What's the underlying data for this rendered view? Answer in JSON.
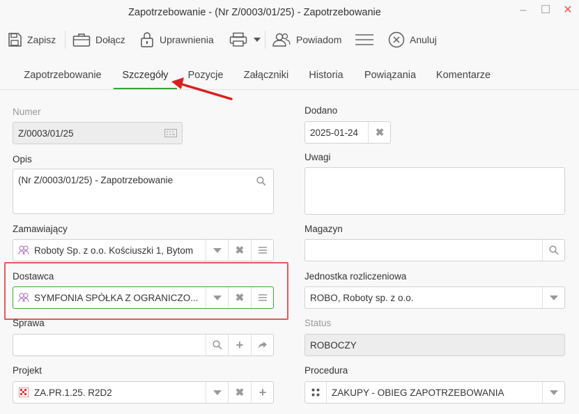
{
  "window": {
    "title": "Zapotrzebowanie - (Nr Z/0003/01/25) - Zapotrzebowanie"
  },
  "toolbar": {
    "save": "Zapisz",
    "attach": "Dołącz",
    "permissions": "Uprawnienia",
    "notify": "Powiadom",
    "cancel": "Anuluj"
  },
  "tabs": [
    "Zapotrzebowanie",
    "Szczegóły",
    "Pozycje",
    "Załączniki",
    "Historia",
    "Powiązania",
    "Komentarze"
  ],
  "active_tab": "Szczegóły",
  "form": {
    "numer": {
      "label": "Numer",
      "value": "Z/0003/01/25"
    },
    "opis": {
      "label": "Opis",
      "value": "(Nr Z/0003/01/25) - Zapotrzebowanie"
    },
    "zamawiajacy": {
      "label": "Zamawiający",
      "value": "Roboty Sp. z o.o. Kościuszki 1, Bytom"
    },
    "dostawca": {
      "label": "Dostawca",
      "value": "SYMFONIA SPÓŁKA Z OGRANICZO..."
    },
    "sprawa": {
      "label": "Sprawa",
      "value": ""
    },
    "projekt": {
      "label": "Projekt",
      "value": "ZA.PR.1.25. R2D2"
    },
    "dodano": {
      "label": "Dodano",
      "value": "2025-01-24"
    },
    "uwagi": {
      "label": "Uwagi",
      "value": ""
    },
    "magazyn": {
      "label": "Magazyn",
      "value": ""
    },
    "jednostka": {
      "label": "Jednostka rozliczeniowa",
      "value": "ROBO, Roboty sp. z o.o."
    },
    "status": {
      "label": "Status",
      "value": "ROBOCZY"
    },
    "procedura": {
      "label": "Procedura",
      "value": "ZAKUPY - OBIEG ZAPOTRZEBOWANIA"
    }
  },
  "colors": {
    "accent": "#3aa335",
    "highlight": "#e15a5a",
    "arrow": "#d92020"
  }
}
